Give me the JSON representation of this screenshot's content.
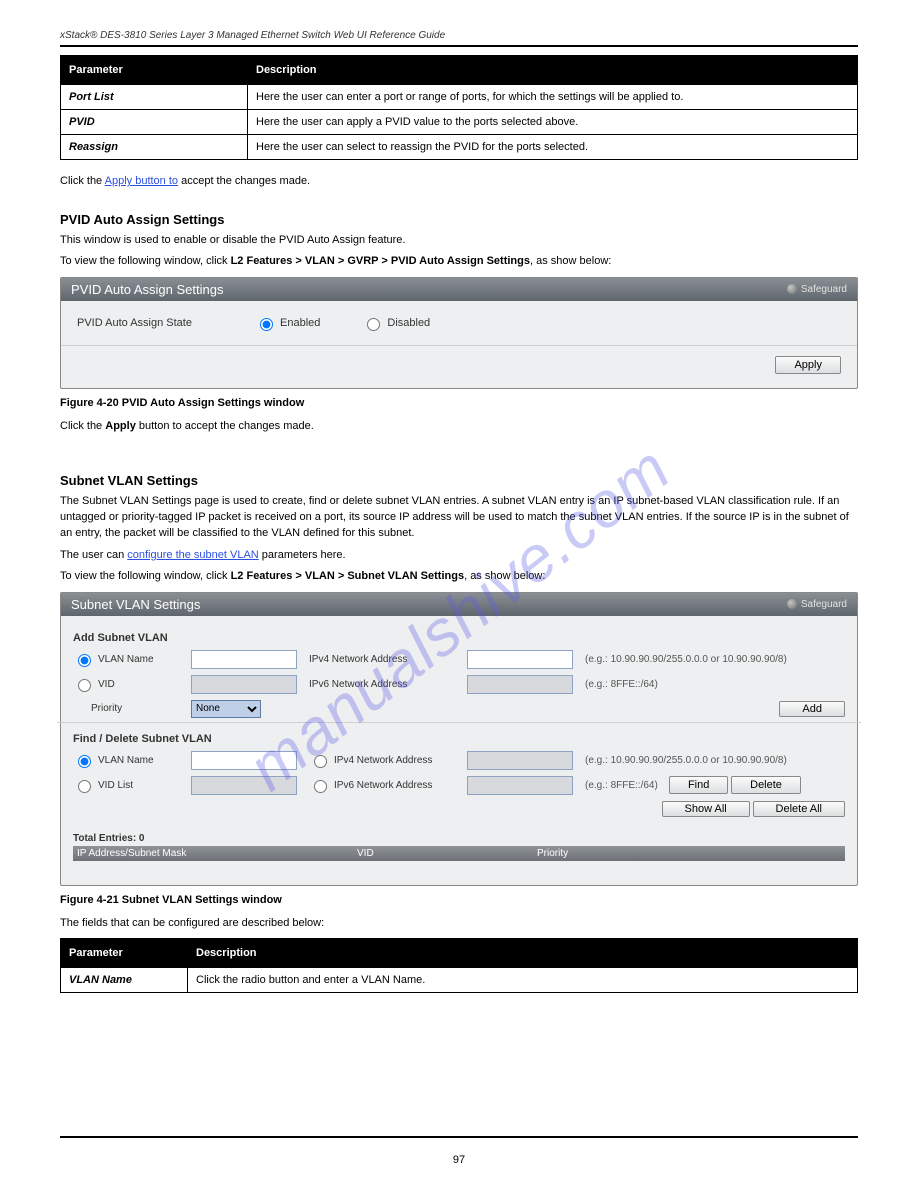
{
  "header": {
    "title": "xStack® DES-3810 Series Layer 3 Managed Ethernet Switch Web UI Reference Guide"
  },
  "table1": {
    "head": {
      "param": "Parameter",
      "desc": "Description"
    },
    "rows": [
      {
        "param": "Port List",
        "desc": "Here the user can enter a port or range of ports, for which the settings will be applied to."
      },
      {
        "param": "PVID",
        "desc": "Here the user can apply a PVID value to the ports selected above."
      },
      {
        "param": "Reassign",
        "desc": "Here the user can select to reassign the PVID for the ports selected."
      }
    ]
  },
  "text": {
    "apply_hint": "Click the Apply button to accept the changes made.",
    "pvid_title": "PVID Auto Assign Settings",
    "pvid_desc": "This window is used to enable or disable the PVID Auto Assign feature.",
    "pvid_nav_prefix": "To view the following window, click ",
    "pvid_nav_path": "L2 Features > VLAN > GVRP > PVID Auto Assign Settings",
    "pvid_suffix": ", as show below:",
    "pvid_fig": "Figure 4-20 PVID Auto Assign Settings window",
    "subnet_title": "Subnet VLAN Settings",
    "subnet_p1": "The Subnet VLAN Settings page is used to create, find or delete subnet VLAN entries. A subnet VLAN entry is an IP subnet-based VLAN classification rule. If an untagged or priority-tagged IP packet is received on a port, its source IP address will be used to match the subnet VLAN entries. If the source IP is in the subnet of an entry, the packet will be classified to the VLAN defined for this subnet.",
    "subnet_p2_prefix": "The user can ",
    "subnet_p2_link": "configure the subnet VLAN",
    "subnet_p2_suffix": " parameters here.",
    "subnet_nav_prefix": "To view the following window, click ",
    "subnet_nav_path": "L2 Features > VLAN > Subnet VLAN Settings",
    "subnet_suffix": ", as show below:",
    "subnet_fig": "Figure 4-21 Subnet VLAN Settings window",
    "fields_intro": "The fields that can be configured are described below:"
  },
  "panel_pvid": {
    "title": "PVID Auto Assign Settings",
    "safeguard": "Safeguard",
    "state_label": "PVID Auto Assign State",
    "enabled": "Enabled",
    "disabled": "Disabled",
    "apply": "Apply"
  },
  "panel_subnet": {
    "title": "Subnet VLAN Settings",
    "safeguard": "Safeguard",
    "add_section": "Add Subnet VLAN",
    "vlan_name": "VLAN Name",
    "vid": "VID",
    "priority": "Priority",
    "priority_sel": "None",
    "ipv4_label": "IPv4 Network Address",
    "ipv6_label": "IPv6 Network Address",
    "hint_ipv4": "(e.g.: 10.90.90.90/255.0.0.0 or 10.90.90.90/8)",
    "hint_ipv6": "(e.g.: 8FFE::/64)",
    "add_btn": "Add",
    "fd_section": "Find / Delete Subnet VLAN",
    "vid_list": "VID List",
    "find_btn": "Find",
    "delete_btn": "Delete",
    "show_all_btn": "Show All",
    "delete_all_btn": "Delete All",
    "total_entries": "Total Entries: 0",
    "col_ip": "IP Address/Subnet Mask",
    "col_vid": "VID",
    "col_priority": "Priority"
  },
  "table2": {
    "head": {
      "param": "Parameter",
      "desc": "Description"
    },
    "rows": [
      {
        "param": "VLAN Name",
        "desc": "Click the radio button and enter a VLAN Name."
      }
    ]
  },
  "footer": {
    "page_number": "97"
  },
  "watermark": "manualshive.com"
}
